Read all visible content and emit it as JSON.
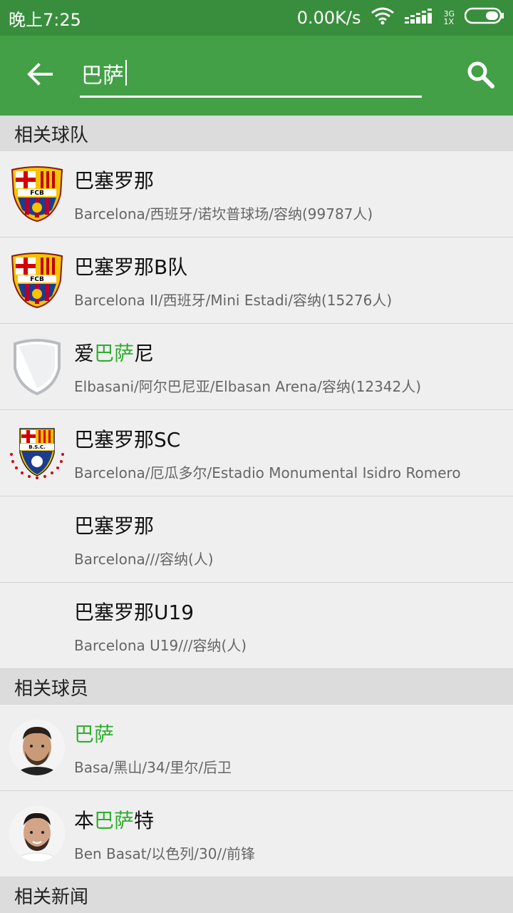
{
  "status": {
    "time": "晚上7:25",
    "net_speed": "0.00K/s",
    "net_type_top": "3G",
    "net_type_bottom": "1X"
  },
  "search": {
    "query": "巴萨"
  },
  "sections": {
    "teams_header": "相关球队",
    "players_header": "相关球员",
    "news_header": "相关新闻"
  },
  "teams": [
    {
      "title": "巴塞罗那",
      "sub": "Barcelona/西班牙/诺坎普球场/容纳(99787人)"
    },
    {
      "title": "巴塞罗那B队",
      "sub": "Barcelona II/西班牙/Mini Estadi/容纳(15276人)"
    },
    {
      "title_pre": "爱",
      "title_hl": "巴萨",
      "title_post": "尼",
      "sub": "Elbasani/阿尔巴尼亚/Elbasan Arena/容纳(12342人)"
    },
    {
      "title": "巴塞罗那SC",
      "sub": "Barcelona/厄瓜多尔/Estadio Monumental Isidro Romero"
    },
    {
      "title": "巴塞罗那",
      "sub": "Barcelona///容纳(人)"
    },
    {
      "title": "巴塞罗那U19",
      "sub": "Barcelona U19///容纳(人)"
    }
  ],
  "players": [
    {
      "title_hl": "巴萨",
      "sub": "Basa/黑山/34/里尔/后卫"
    },
    {
      "title_pre": "本",
      "title_hl": "巴萨",
      "title_post": "特",
      "sub": "Ben Basat/以色列/30//前锋"
    }
  ],
  "colors": {
    "statusbar": "#388e3c",
    "toolbar": "#43a047",
    "highlight": "#2eae2e"
  }
}
